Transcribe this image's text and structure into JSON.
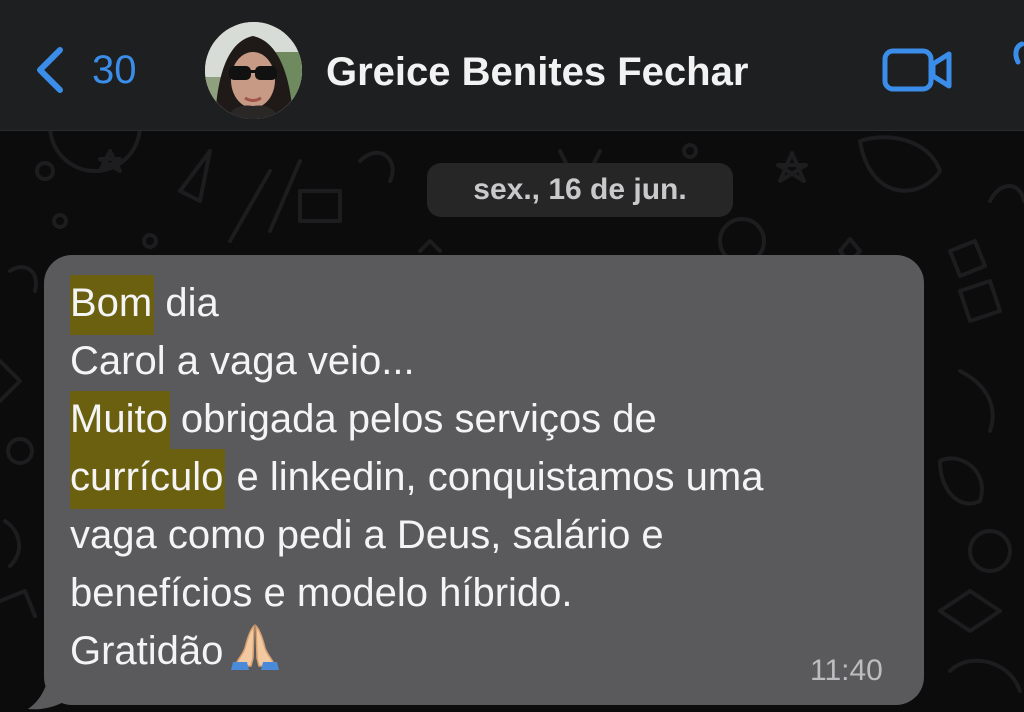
{
  "header": {
    "back_count": "30",
    "contact_name": "Greice Benites Fechar",
    "icons": {
      "back": "chevron-left-icon",
      "video": "video-camera-icon",
      "call": "phone-icon"
    },
    "accent_color": "#3a8eea"
  },
  "chat": {
    "date_label": "sex., 16 de jun.",
    "message": {
      "lines": [
        {
          "highlight": "Bom",
          "rest": " dia"
        },
        {
          "highlight": "",
          "rest": "Carol a vaga veio..."
        },
        {
          "highlight": "Muito",
          "rest": " obrigada pelos serviços de"
        },
        {
          "highlight": "currículo",
          "rest": " e linkedin, conquistamos uma"
        },
        {
          "highlight": "",
          "rest": "vaga como pedi a Deus, salário e"
        },
        {
          "highlight": "",
          "rest": "benefícios e modelo híbrido."
        },
        {
          "highlight": "",
          "rest": "Gratidão"
        }
      ],
      "emoji": "🙏",
      "time": "11:40",
      "highlight_color": "#6a6010",
      "bubble_color": "#5a5a5d"
    }
  }
}
